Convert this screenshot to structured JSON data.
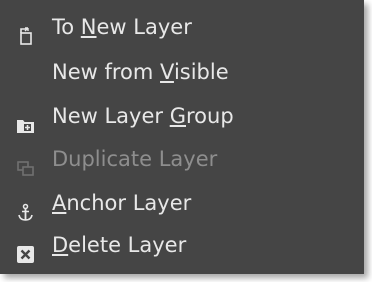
{
  "menu": {
    "items": [
      {
        "pre": "To ",
        "key": "N",
        "post": "ew Layer",
        "icon": "to-new-layer-icon",
        "enabled": true
      },
      {
        "pre": "New from ",
        "key": "V",
        "post": "isible",
        "icon": "",
        "enabled": true
      },
      {
        "pre": "New Layer ",
        "key": "G",
        "post": "roup",
        "icon": "new-layer-group-icon",
        "enabled": true
      },
      {
        "pre": "Duplicate Layer",
        "key": "",
        "post": "",
        "icon": "duplicate-layer-icon",
        "enabled": false
      },
      {
        "pre": "",
        "key": "A",
        "post": "nchor Layer",
        "icon": "anchor-icon",
        "enabled": true
      },
      {
        "pre": "",
        "key": "D",
        "post": "elete Layer",
        "icon": "delete-icon",
        "enabled": true
      }
    ]
  },
  "colors": {
    "menu_background": "#454545",
    "text": "#e8e8e8",
    "disabled_text": "#8e8e8e"
  }
}
